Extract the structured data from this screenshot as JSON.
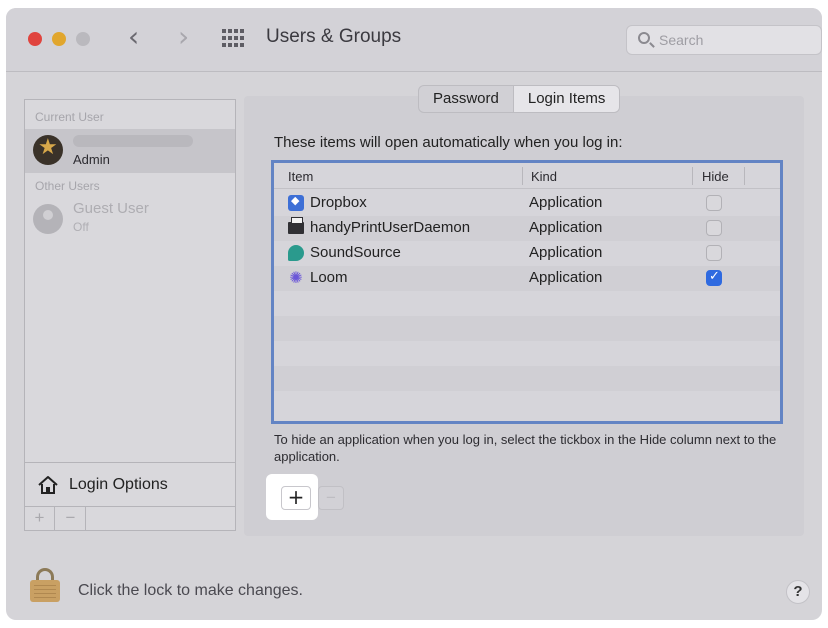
{
  "window": {
    "title": "Users & Groups",
    "search_placeholder": "Search"
  },
  "sidebar": {
    "current_user_header": "Current User",
    "current_user": {
      "role": "Admin"
    },
    "other_users_header": "Other Users",
    "guest": {
      "name": "Guest User",
      "status": "Off"
    },
    "login_options_label": "Login Options",
    "add_label": "+",
    "remove_label": "−"
  },
  "tabs": [
    {
      "label": "Password",
      "selected": false
    },
    {
      "label": "Login Items",
      "selected": true
    }
  ],
  "main": {
    "description": "These items will open automatically when you log in:",
    "columns": {
      "item": "Item",
      "kind": "Kind",
      "hide": "Hide"
    },
    "items": [
      {
        "name": "Dropbox",
        "kind": "Application",
        "hide": false,
        "icon": "dropbox-icon"
      },
      {
        "name": "handyPrintUserDaemon",
        "kind": "Application",
        "hide": false,
        "icon": "printer-icon"
      },
      {
        "name": "SoundSource",
        "kind": "Application",
        "hide": false,
        "icon": "soundsource-icon"
      },
      {
        "name": "Loom",
        "kind": "Application",
        "hide": true,
        "icon": "loom-icon"
      }
    ],
    "hint": "To hide an application when you log in, select the tickbox in the Hide column next to the application.",
    "add_label": "+",
    "remove_label": "−"
  },
  "footer": {
    "lock_text": "Click the lock to make changes.",
    "help_label": "?"
  },
  "colors": {
    "accent": "#2f6ae0",
    "table_focus": "#6384c4",
    "close": "#e0443e",
    "minimize": "#e1a62d"
  }
}
